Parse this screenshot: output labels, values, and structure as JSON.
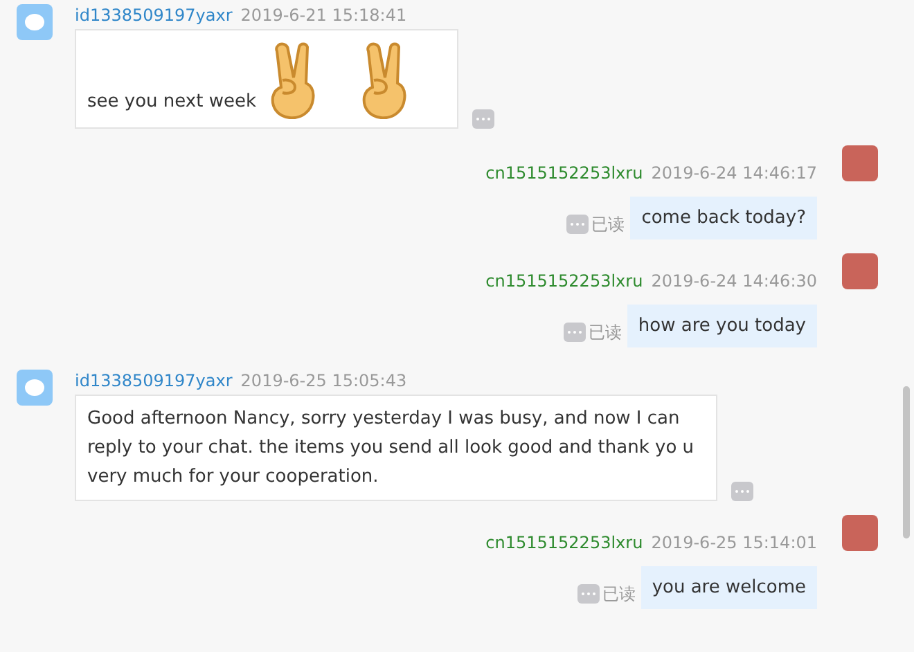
{
  "messages": [
    {
      "kind": "incoming",
      "sender": "id1338509197yaxr",
      "time": "2019-6-21 15:18:41",
      "text": "see you next week",
      "stickers": [
        {
          "kind": "victory-hand"
        },
        {
          "kind": "victory-hand"
        }
      ]
    },
    {
      "kind": "outgoing",
      "sender": "cn1515152253lxru",
      "time": "2019-6-24 14:46:17",
      "text": "come back today?",
      "read": "已读"
    },
    {
      "kind": "outgoing",
      "sender": "cn1515152253lxru",
      "time": "2019-6-24 14:46:30",
      "text": "how are you today",
      "read": "已读"
    },
    {
      "kind": "incoming",
      "sender": "id1338509197yaxr",
      "time": "2019-6-25 15:05:43",
      "text": "Good afternoon Nancy, sorry yesterday I was busy, and now I can reply to your chat.  the items you send all look good and thank yo u very much for your cooperation."
    },
    {
      "kind": "outgoing",
      "sender": "cn1515152253lxru",
      "time": "2019-6-25 15:14:01",
      "text": "you are welcome",
      "read": "已读"
    }
  ]
}
